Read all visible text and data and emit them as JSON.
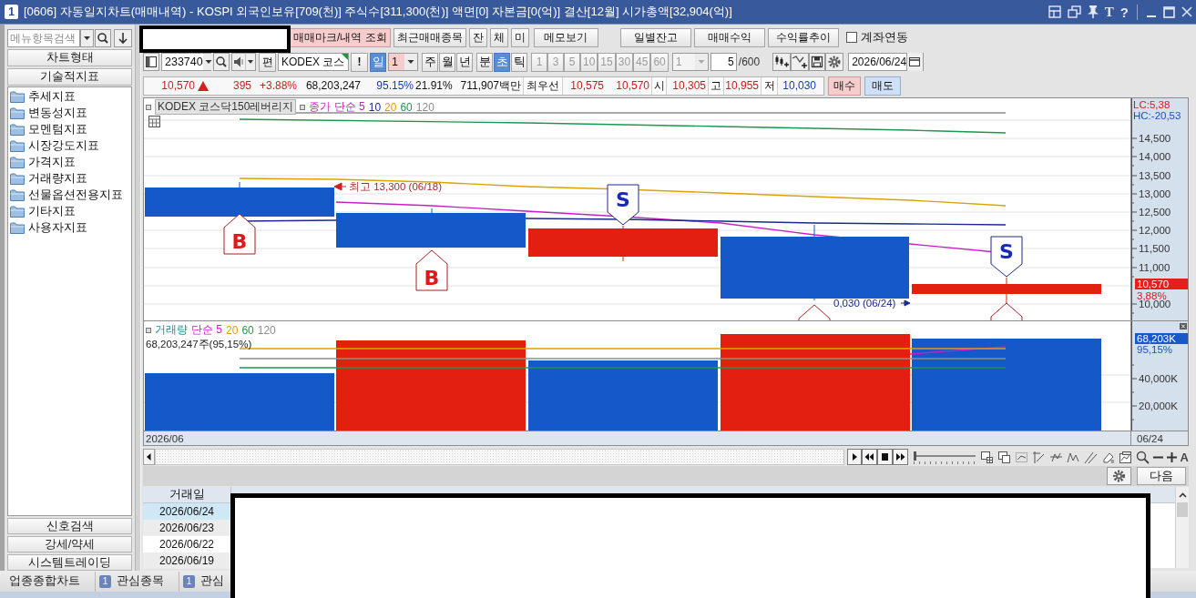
{
  "title_bar": {
    "badge": "1",
    "title": "[0606] 자동일지차트(매매내역) - KOSPI 외국인보유[709(천)] 주식수[311,300(천)] 액면[0] 자본금[0(억)] 결산[12월] 시가총액[32,904(억)]",
    "tools": [
      "T",
      "?"
    ]
  },
  "sidebar": {
    "search": {
      "placeholder": "메뉴항목검색"
    },
    "top_buttons": [
      "차트형태",
      "기술적지표"
    ],
    "items": [
      "추세지표",
      "변동성지표",
      "모멘텀지표",
      "시장강도지표",
      "가격지표",
      "거래량지표",
      "선물옵션전용지표",
      "기타지표",
      "사용자지표"
    ],
    "bottom_buttons": [
      "신호검색",
      "강세/약세",
      "시스템트레이딩"
    ]
  },
  "action_bar": {
    "buttons": [
      {
        "label": "매매마크/내역 조회",
        "selected": true
      },
      {
        "label": "최근매매종목",
        "selected": false
      },
      {
        "label": "잔",
        "selected": false
      },
      {
        "label": "체",
        "selected": false
      },
      {
        "label": "미",
        "selected": false
      },
      {
        "label": "메모보기",
        "selected": false
      }
    ],
    "report_buttons": [
      "일별잔고",
      "매매수익",
      "수익률추이"
    ],
    "account_link": {
      "label": "계좌연동",
      "checked": false
    }
  },
  "symbol_bar": {
    "code": "233740",
    "edit_button": "편",
    "name": "KODEX 코스",
    "alert_button": "!",
    "day": {
      "label": "일",
      "selected": true
    },
    "day_count": "1",
    "periods": [
      {
        "label": "주",
        "selected": false
      },
      {
        "label": "월",
        "selected": false
      },
      {
        "label": "년",
        "selected": false
      }
    ],
    "intraday": [
      {
        "label": "분",
        "selected": false
      },
      {
        "label": "초",
        "selected": true
      },
      {
        "label": "틱",
        "selected": false
      }
    ],
    "intervals": [
      {
        "label": "1",
        "disabled": true
      },
      {
        "label": "3",
        "disabled": true
      },
      {
        "label": "5",
        "disabled": true
      },
      {
        "label": "10",
        "disabled": true
      },
      {
        "label": "15",
        "disabled": true
      },
      {
        "label": "30",
        "disabled": true
      },
      {
        "label": "45",
        "disabled": true
      },
      {
        "label": "60",
        "disabled": true
      }
    ],
    "interval_count": {
      "value": "1",
      "disabled": true
    },
    "bar_count": "5",
    "bar_max": "/600",
    "date": "2026/06/24"
  },
  "quote": {
    "price": {
      "text": "10,570",
      "color": "#c81e1e"
    },
    "rising": true,
    "cells": [
      {
        "kind": "value",
        "text": "395",
        "color": "#c81e1e"
      },
      {
        "kind": "value",
        "text": "+3.88%",
        "color": "#c81e1e"
      },
      {
        "kind": "value",
        "text": "68,203,247",
        "color": "#111111"
      },
      {
        "kind": "value",
        "text": "95.15%",
        "color": "#1a3ea8"
      },
      {
        "kind": "value",
        "text": "21.91%",
        "color": "#111111"
      },
      {
        "kind": "value",
        "text": "711,907백만",
        "color": "#111111"
      },
      {
        "kind": "label",
        "text": "최우선"
      },
      {
        "kind": "value",
        "text": "10,575",
        "color": "#c81e1e"
      },
      {
        "kind": "value",
        "text": "10,570",
        "color": "#c81e1e"
      },
      {
        "kind": "label",
        "text": "시"
      },
      {
        "kind": "value",
        "text": "10,305",
        "color": "#c81e1e"
      },
      {
        "kind": "label",
        "text": "고"
      },
      {
        "kind": "value",
        "text": "10,955",
        "color": "#c81e1e"
      },
      {
        "kind": "label",
        "text": "저"
      },
      {
        "kind": "value",
        "text": "10,030",
        "color": "#1a3ea8"
      }
    ],
    "buy_button": "매수",
    "sell_button": "매도"
  },
  "chart": {
    "price_pane": {
      "legend": {
        "name": "KODEX 코스닥150레버리지",
        "series": [
          {
            "label": "종가 단순 5",
            "color": "#c81ec8"
          },
          {
            "label": "10",
            "color": "#1c2a8c"
          },
          {
            "label": "20",
            "color": "#e0a000"
          },
          {
            "label": "60",
            "color": "#1e9650"
          },
          {
            "label": "120",
            "color": "#8c8c8c"
          }
        ]
      },
      "range_labels": [
        {
          "text": "LC:5,38",
          "color": "#d02020"
        },
        {
          "text": "HC:-20,53",
          "color": "#1a50c0"
        }
      ],
      "yticks": [
        "14,500",
        "14,000",
        "13,500",
        "13,000",
        "12,500",
        "12,000",
        "11,500",
        "11,000",
        "10,000"
      ],
      "last_price": "10,570",
      "last_rate": "3,88%",
      "annotations": [
        {
          "kind": "high",
          "text": "최고 13,300 (06/18)"
        },
        {
          "kind": "low",
          "text": "0,030 (06/24)"
        }
      ],
      "markers": [
        {
          "kind": "buy",
          "label": "B"
        },
        {
          "kind": "buy",
          "label": "B"
        },
        {
          "kind": "sell",
          "label": "S"
        },
        {
          "kind": "buy"
        },
        {
          "kind": "sell",
          "label": "S"
        },
        {
          "kind": "buy"
        }
      ]
    },
    "volume_pane": {
      "legend": [
        {
          "label": "거래량",
          "color": "#1e8c96"
        },
        {
          "label": "단순 5",
          "color": "#c81ec8"
        },
        {
          "label": "20",
          "color": "#e0a000"
        },
        {
          "label": "60",
          "color": "#1e9650"
        },
        {
          "label": "120",
          "color": "#8c8c8c"
        }
      ],
      "summary": "68,203,247주(95,15%)",
      "last_value": "68,203K",
      "last_rate": "95,15%",
      "yticks": [
        "40,000K",
        "20,000K"
      ]
    },
    "x_axis": {
      "start": "2026/06",
      "end": "06/24"
    }
  },
  "chart_tools": {
    "zoom_slider": {
      "level": 0.02
    },
    "text_tool": "A"
  },
  "trade_panel": {
    "next_button": "다음",
    "columns": [
      "거래일"
    ],
    "rows": [
      {
        "date": "2026/06/24",
        "selected": true
      },
      {
        "date": "2026/06/23",
        "selected": false
      },
      {
        "date": "2026/06/22",
        "selected": false
      },
      {
        "date": "2026/06/19",
        "selected": false
      }
    ]
  },
  "taskbar": {
    "items": [
      {
        "label": "업종종합차트"
      },
      {
        "badge": "1",
        "label": "관심종목"
      },
      {
        "badge": "1",
        "label": "관심"
      }
    ]
  }
}
